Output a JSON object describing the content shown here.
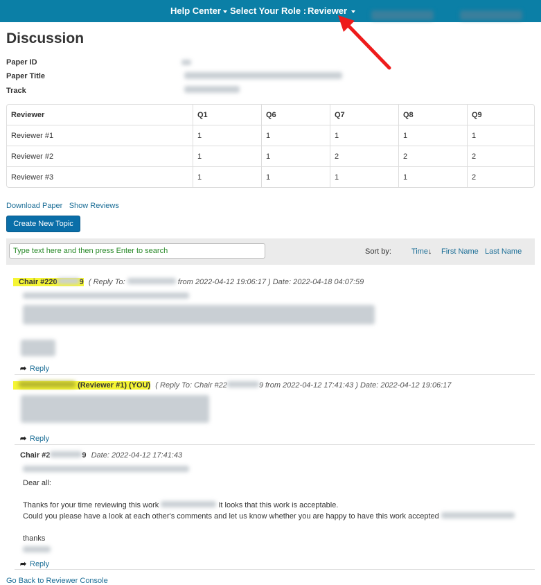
{
  "nav": {
    "help_center": "Help Center",
    "select_role": "Select Your Role :",
    "role": "Reviewer"
  },
  "page_title": "Discussion",
  "meta_labels": {
    "paper_id": "Paper ID",
    "paper_title": "Paper Title",
    "track": "Track"
  },
  "scores": {
    "headers": [
      "Reviewer",
      "Q1",
      "Q6",
      "Q7",
      "Q8",
      "Q9"
    ],
    "rows": [
      [
        "Reviewer #1",
        "1",
        "1",
        "1",
        "1",
        "1"
      ],
      [
        "Reviewer #2",
        "1",
        "1",
        "2",
        "2",
        "2"
      ],
      [
        "Reviewer #3",
        "1",
        "1",
        "1",
        "1",
        "2"
      ]
    ]
  },
  "links": {
    "download_paper": "Download Paper",
    "show_reviews": "Show Reviews"
  },
  "create_topic": "Create New Topic",
  "search": {
    "placeholder": "Type text here and then press Enter to search"
  },
  "sort": {
    "label": "Sort by:",
    "time": "Time",
    "first_name": "First Name",
    "last_name": "Last Name"
  },
  "messages": [
    {
      "author_prefix": "Chair #220",
      "author_suffix": "9",
      "info_a": "( Reply To:",
      "info_b": "from 2022-04-12 19:06:17 ) Date: 2022-04-18 04:07:59",
      "reply": "Reply"
    },
    {
      "author": "(Reviewer #1)  (YOU)",
      "info_a": "( Reply To: Chair #22",
      "info_b": "9 from 2022-04-12 17:41:43 ) Date: 2022-04-12 19:06:17",
      "reply": "Reply"
    },
    {
      "author_prefix": "Chair #2",
      "author_suffix": "9",
      "info": "Date: 2022-04-12 17:41:43",
      "greeting": "Dear all:",
      "line1_a": "Thanks for your time reviewing this work",
      "line1_b": "It looks that this work is acceptable.",
      "line2": "Could you please have a look at each other's comments and let us know whether you are happy to have this work accepted",
      "sign": "thanks",
      "reply": "Reply"
    }
  ],
  "back_link": "Go Back to Reviewer Console",
  "colors": {
    "topbar": "#0b7fa6",
    "highlight": "#f5f534",
    "link": "#1a6d96",
    "button": "#0a6ea8"
  }
}
